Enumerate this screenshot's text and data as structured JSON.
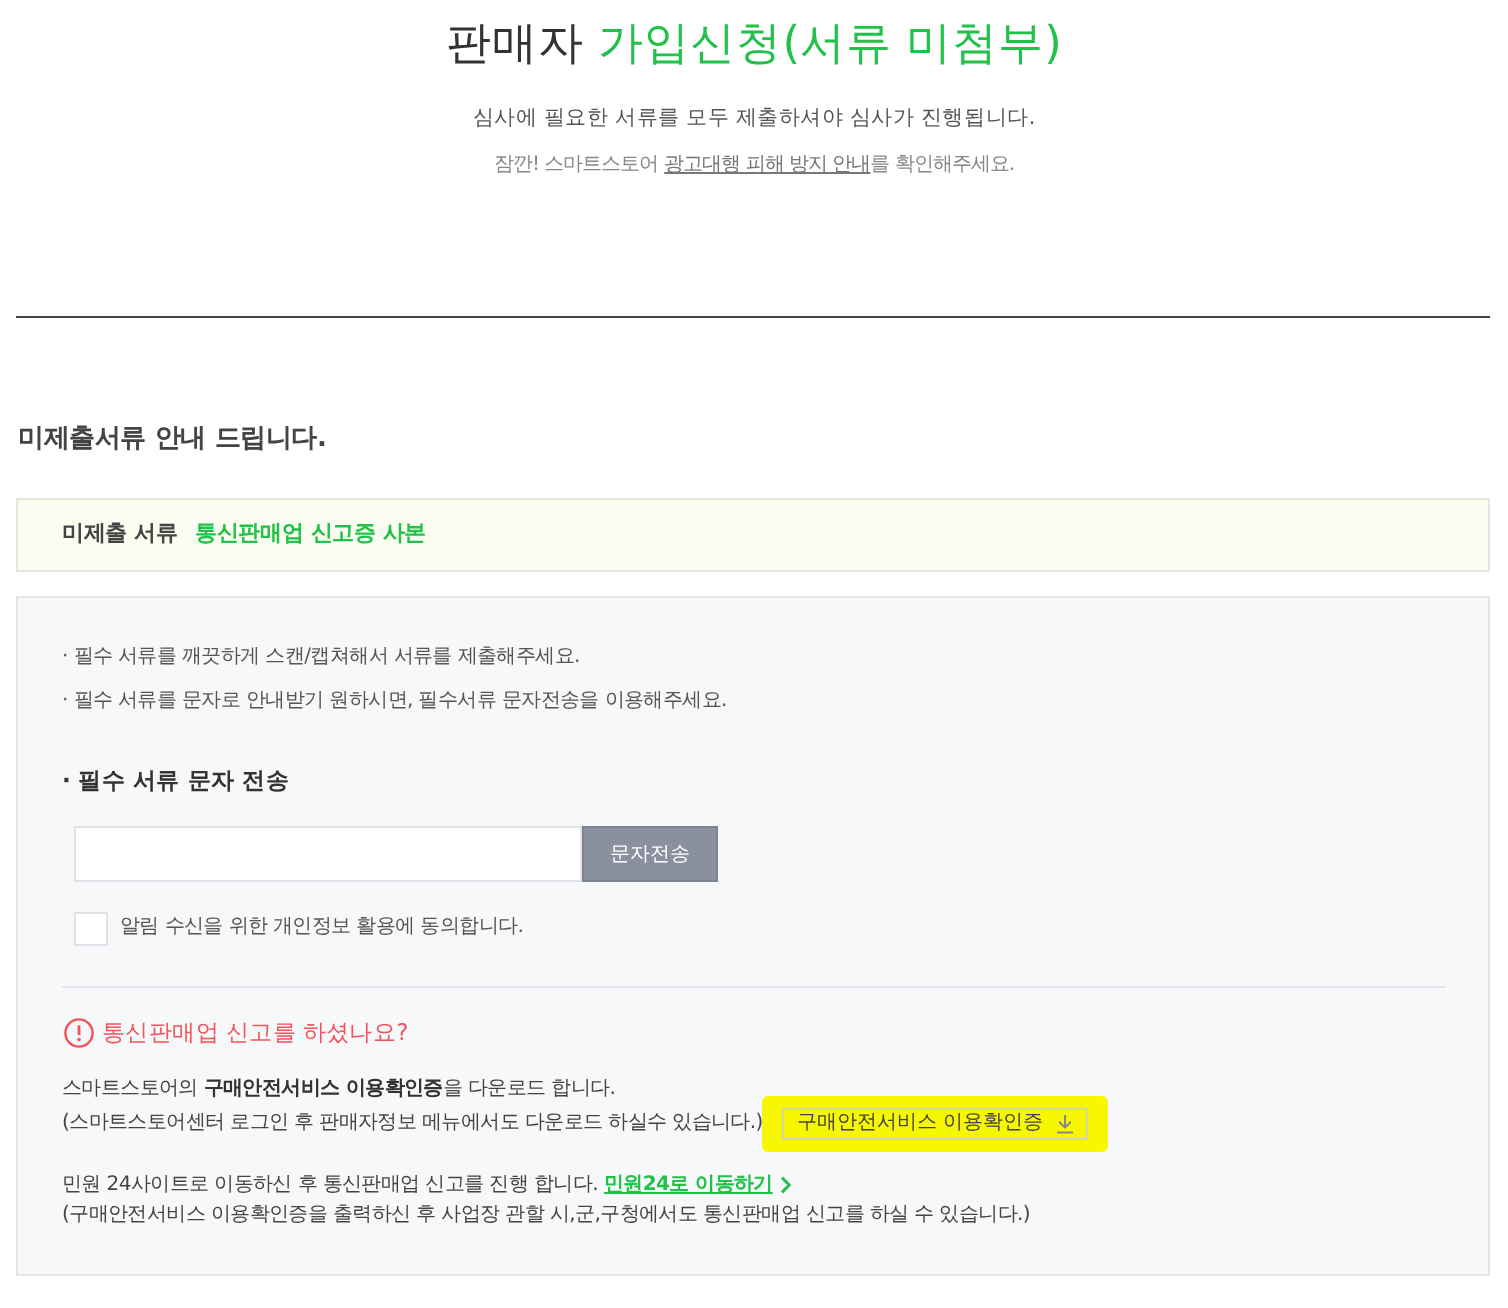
{
  "header": {
    "title": "판매자 **가입신청(서류 미첨부)**",
    "subtitle": "심사에 필요한 서류를 모두 제출하셔야 심사가 진행됩니다.",
    "notice": {
      "before": "잠깐! 스마트스토어",
      "link": "광고대행 피해 방지 안내",
      "after": "를 확인해주세요."
    }
  },
  "section_title": "미제출서류 안내 드립니다.",
  "missing_documents": {
    "label": "미제출 서류",
    "value": "통신판매업 신고증 사본"
  },
  "panel": {
    "bullets": [
      "· 필수 서류를 깨끗하게 스캔/캡쳐해서 서류를 제출해주세요.",
      "· 필수 서류를 문자로 안내받기 원하시면, 필수서류 문자전송을 이용해주세요."
    ],
    "sms": {
      "heading": "· 필수 서류 문자 전송",
      "button": "문자전송",
      "consent": {
        "label": "알림 수신을 위한 개인정보 활용에 동의합니다.",
        "checked": false
      }
    },
    "report": {
      "heading": "통신판매업 신고를 하셨나요?",
      "download_lines": [
        "스마트스토어의 **구매안전서비스 이용확인증**을 다운로드 합니다.",
        "(스마트스토어센터 로그인 후 판매자정보 메뉴에서도 다운로드 하실수 있습니다.)"
      ],
      "download_button": {
        "label": "구매안전서비스 이용확인증",
        "highlighted": true
      },
      "minwon": {
        "text": "민원 24사이트로 이동하신 후 통신판매업 신고를 진행 합니다.",
        "link": "민원24로 이동하기",
        "note": "(구매안전서비스 이용확인증을 출력하신 후 사업장 관할 시,군,구청에서도 통신판매업 신고를 하실 수 있습니다.)"
      }
    }
  }
}
